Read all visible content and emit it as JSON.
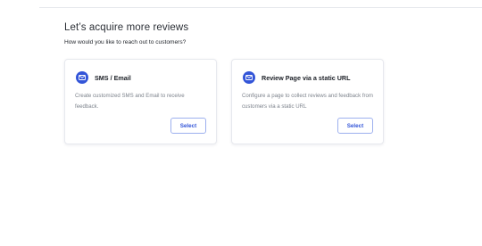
{
  "header": {
    "title": "Let’s acquire more reviews",
    "subtitle": "How would you like to reach out to customers?"
  },
  "cards": [
    {
      "icon": "message-icon",
      "title": "SMS / Email",
      "description": "Create customized SMS and Email to receive feedback.",
      "button_label": "Select"
    },
    {
      "icon": "link-icon",
      "title": "Review Page via a static URL",
      "description": "Configure a page to collect reviews and feedback from customers via a static URL",
      "button_label": "Select"
    }
  ],
  "colors": {
    "accent": "#3355d8",
    "button_border": "#9db0ee",
    "card_border": "#e7e9ee",
    "heading_text": "#2b2f36",
    "body_text": "#7d838c"
  }
}
